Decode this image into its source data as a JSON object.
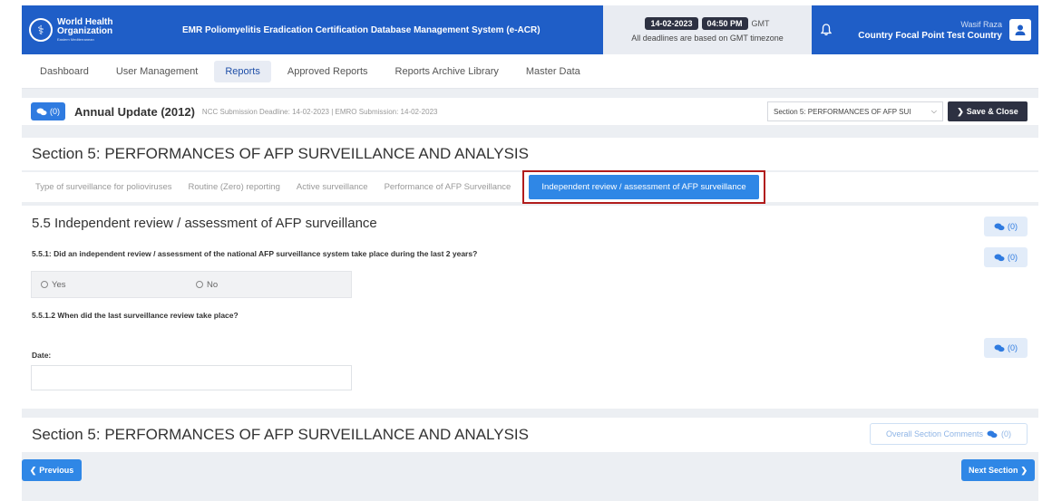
{
  "header": {
    "logo": {
      "line1": "World Health",
      "line2": "Organization",
      "line3": "Eastern Mediterranean"
    },
    "system_title": "EMR Poliomyelitis Eradication Certification Database Management System (e-ACR)",
    "date": "14-02-2023",
    "time": "04:50 PM",
    "timezone": "GMT",
    "deadline_note": "All deadlines are based on GMT timezone",
    "user_name": "Wasif Raza",
    "user_role": "Country Focal Point Test Country"
  },
  "nav": {
    "items": [
      {
        "label": "Dashboard"
      },
      {
        "label": "User Management"
      },
      {
        "label": "Reports"
      },
      {
        "label": "Approved Reports"
      },
      {
        "label": "Reports Archive Library"
      },
      {
        "label": "Master Data"
      }
    ],
    "active": "Reports"
  },
  "topbar": {
    "comment_count": "(0)",
    "report_title": "Annual Update (2012)",
    "deadline_text": "NCC Submission Deadline: 14-02-2023 | EMRO Submission: 14-02-2023",
    "section_select_value": "Section 5: PERFORMANCES OF AFP SUI",
    "save_close_label": "Save & Close"
  },
  "section_title": "Section 5: PERFORMANCES OF AFP SURVEILLANCE AND ANALYSIS",
  "subtabs": [
    {
      "label": "Type of surveillance for polioviruses"
    },
    {
      "label": "Routine (Zero) reporting"
    },
    {
      "label": "Active surveillance"
    },
    {
      "label": "Performance of AFP Surveillance"
    },
    {
      "label": "Independent review / assessment of AFP surveillance"
    }
  ],
  "form": {
    "title": "5.5 Independent review / assessment of AFP surveillance",
    "q1": "5.5.1: Did an independent review / assessment of the national AFP surveillance system take place during the last 2 years?",
    "yes_label": "Yes",
    "no_label": "No",
    "q2": "5.5.1.2 When did the last surveillance review take place?",
    "date_label": "Date:",
    "date_value": "",
    "comment_count": "(0)"
  },
  "footer": {
    "section_title": "Section 5: PERFORMANCES OF AFP SURVEILLANCE AND ANALYSIS",
    "overall_comments_label": "Overall Section Comments",
    "overall_comment_count": "(0)",
    "previous_label": "Previous",
    "next_label": "Next Section"
  },
  "colors": {
    "primary": "#1f5ec7",
    "accent": "#2f87e6",
    "dark": "#2d3142",
    "highlight_border": "#b11c1c"
  }
}
